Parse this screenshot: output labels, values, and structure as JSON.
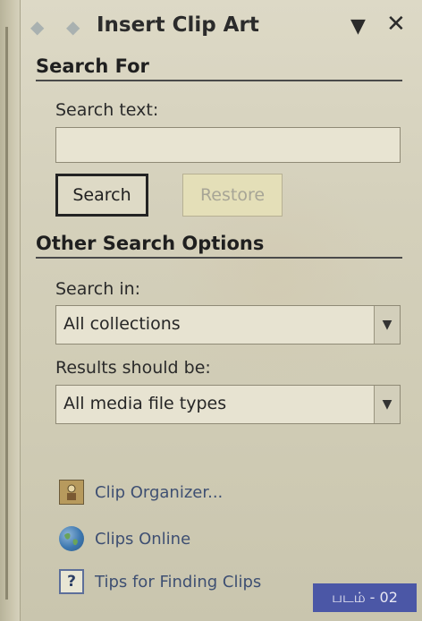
{
  "pane": {
    "title": "Insert Clip Art",
    "back_icon": "back-arrow",
    "forward_icon": "forward-arrow",
    "menu_icon": "dropdown-triangle",
    "close_glyph": "✕"
  },
  "search_for": {
    "heading": "Search For",
    "search_text_label": "Search text:",
    "search_text_value": "",
    "search_button": "Search",
    "restore_button": "Restore"
  },
  "other_options": {
    "heading": "Other Search Options",
    "search_in_label": "Search in:",
    "search_in_value": "All collections",
    "results_label": "Results should be:",
    "results_value": "All media file types"
  },
  "links": {
    "clip_organizer": "Clip Organizer...",
    "clips_online": "Clips Online",
    "tips": "Tips for Finding Clips"
  },
  "figure_tag": "படம் - 02",
  "colors": {
    "link": "#3e4f72",
    "tag_bg": "#4b57a6",
    "restore_bg": "#e4dfb8"
  }
}
